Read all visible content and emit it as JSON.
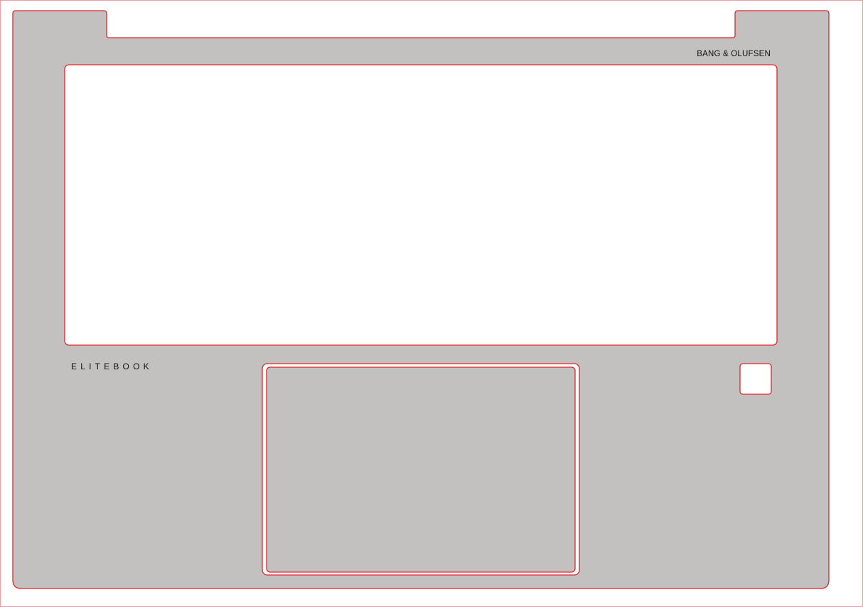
{
  "brands": {
    "top_right": "BANG & OLUFSEN",
    "model": "ELITEBOOK"
  },
  "colors": {
    "page_background": "#ffffff",
    "outline": "#e0242a",
    "body_fill": "#c2c1c0",
    "cutout_fill": "#ffffff",
    "text": "#111111"
  }
}
